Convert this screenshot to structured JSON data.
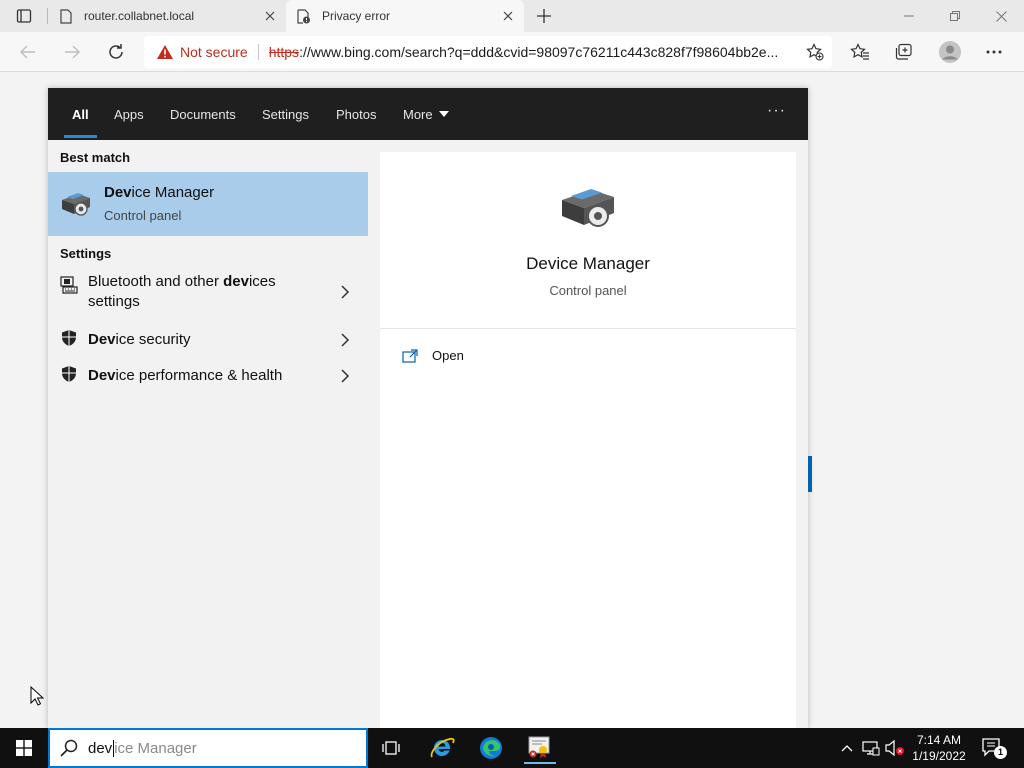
{
  "browser": {
    "tabs": [
      {
        "label": "router.collabnet.local"
      },
      {
        "label": "Privacy error"
      }
    ],
    "address": {
      "security_label": "Not secure",
      "url_scheme": "https",
      "url_rest": "://www.bing.com/search?q=ddd&cvid=98097c76211c443c828f7f98604bb2e..."
    }
  },
  "search_panel": {
    "filters": [
      "All",
      "Apps",
      "Documents",
      "Settings",
      "Photos",
      "More"
    ],
    "active_filter": "All",
    "overflow_label": "···",
    "best_match_header": "Best match",
    "best_match": {
      "title_bold": "Dev",
      "title_rest": "ice Manager",
      "subtitle": "Control panel"
    },
    "settings_header": "Settings",
    "settings_items": [
      {
        "pre": "Bluetooth and other ",
        "bold": "dev",
        "post": "ices",
        "line2": "settings"
      },
      {
        "pre": "",
        "bold": "Dev",
        "post": "ice security",
        "line2": ""
      },
      {
        "pre": "",
        "bold": "Dev",
        "post": "ice performance & health",
        "line2": ""
      }
    ],
    "preview": {
      "title": "Device Manager",
      "subtitle": "Control panel",
      "open_label": "Open"
    }
  },
  "taskbar": {
    "search_typed": "dev",
    "search_suggestion": "ice Manager",
    "clock_time": "7:14 AM",
    "clock_date": "1/19/2022",
    "notification_count": "1"
  },
  "colors": {
    "accent": "#0078d7",
    "best_match_bg": "#a8ccea",
    "warning_red": "#c42b1c",
    "filter_bar": "#1f1f1f"
  }
}
